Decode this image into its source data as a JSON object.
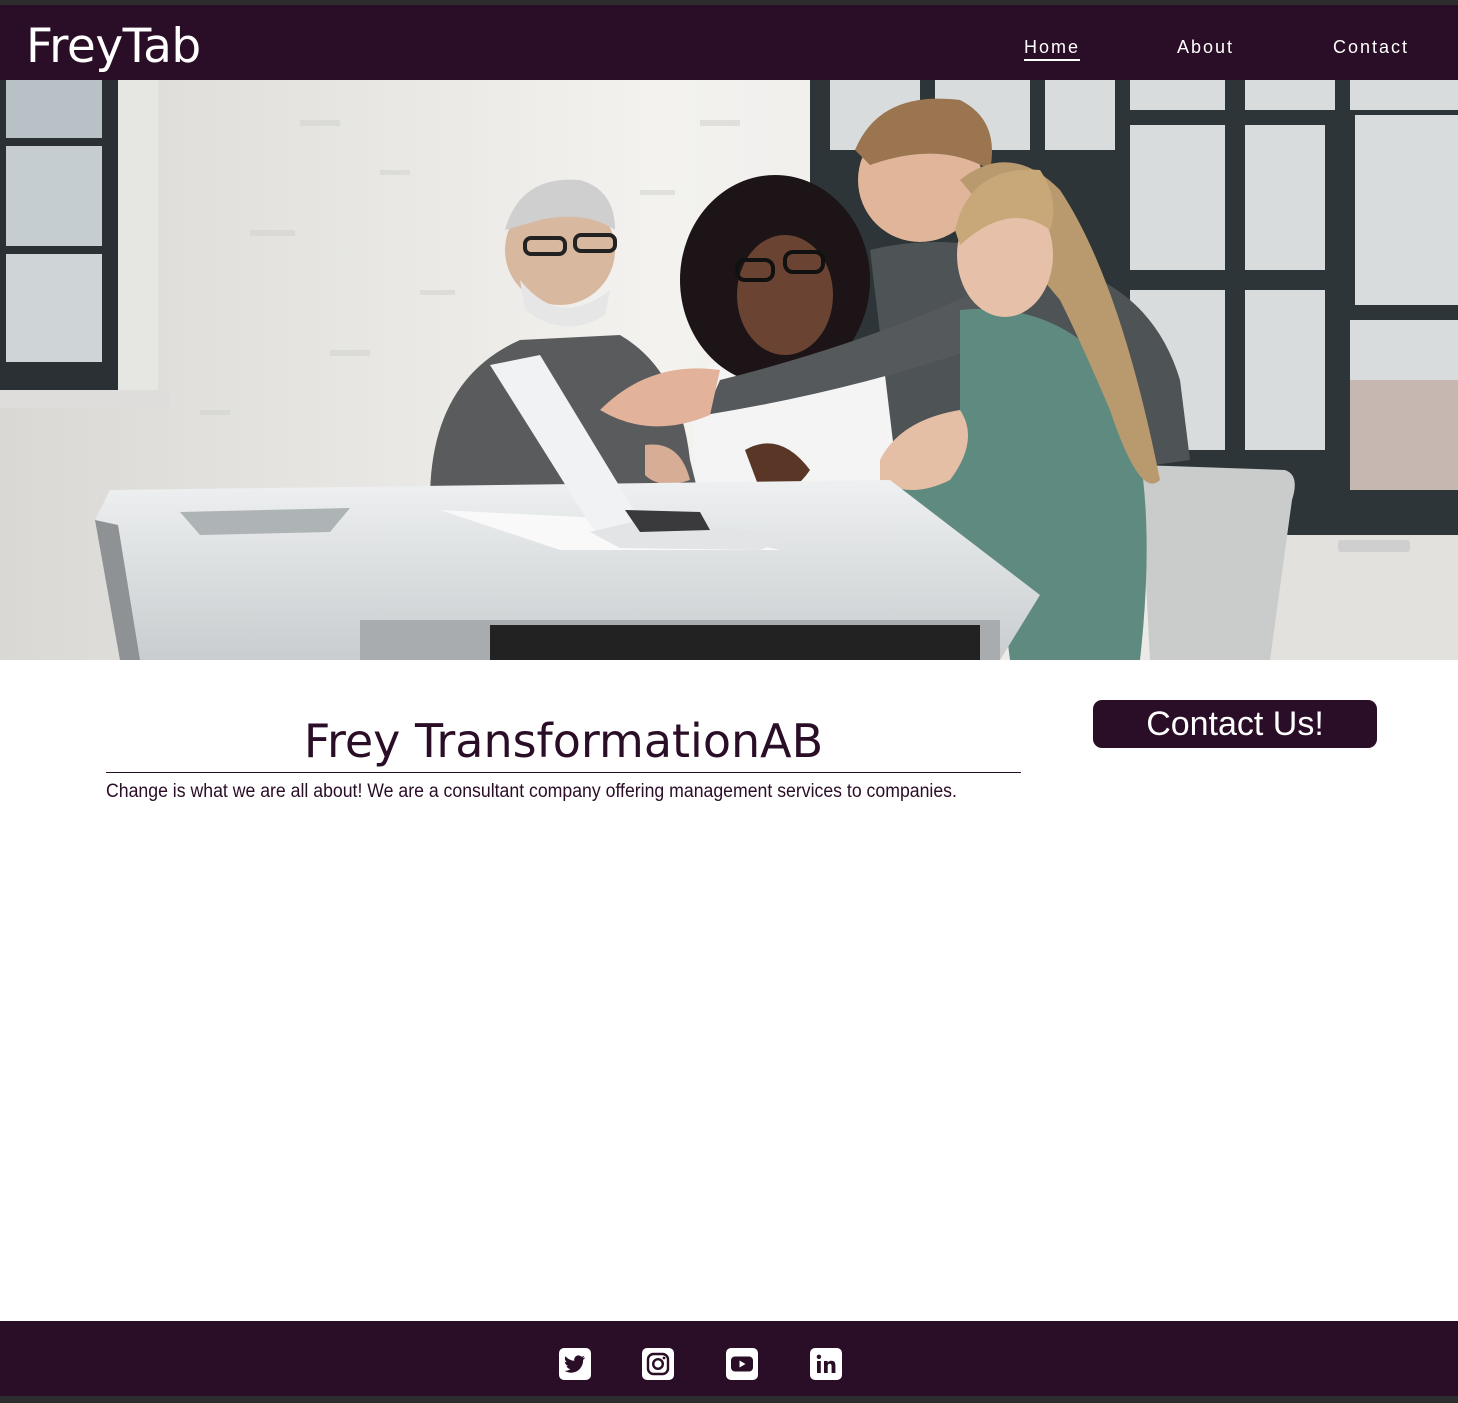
{
  "brand": {
    "logo_text": "FreyTab"
  },
  "nav": {
    "items": [
      {
        "label": "Home",
        "active": true
      },
      {
        "label": "About",
        "active": false
      },
      {
        "label": "Contact",
        "active": false
      }
    ]
  },
  "hero": {
    "icon": "team-meeting-photo"
  },
  "main": {
    "title": "Frey TransformationAB",
    "tagline": "Change is what we are all about! We are a consultant company offering management services to companies.",
    "cta_label": "Contact Us!"
  },
  "footer": {
    "social": [
      {
        "icon": "twitter-icon"
      },
      {
        "icon": "instagram-icon"
      },
      {
        "icon": "youtube-icon"
      },
      {
        "icon": "linkedin-icon"
      }
    ]
  },
  "colors": {
    "brand": "#2a0d26",
    "text_light": "#ffffff",
    "frame": "#2d2d2d"
  }
}
